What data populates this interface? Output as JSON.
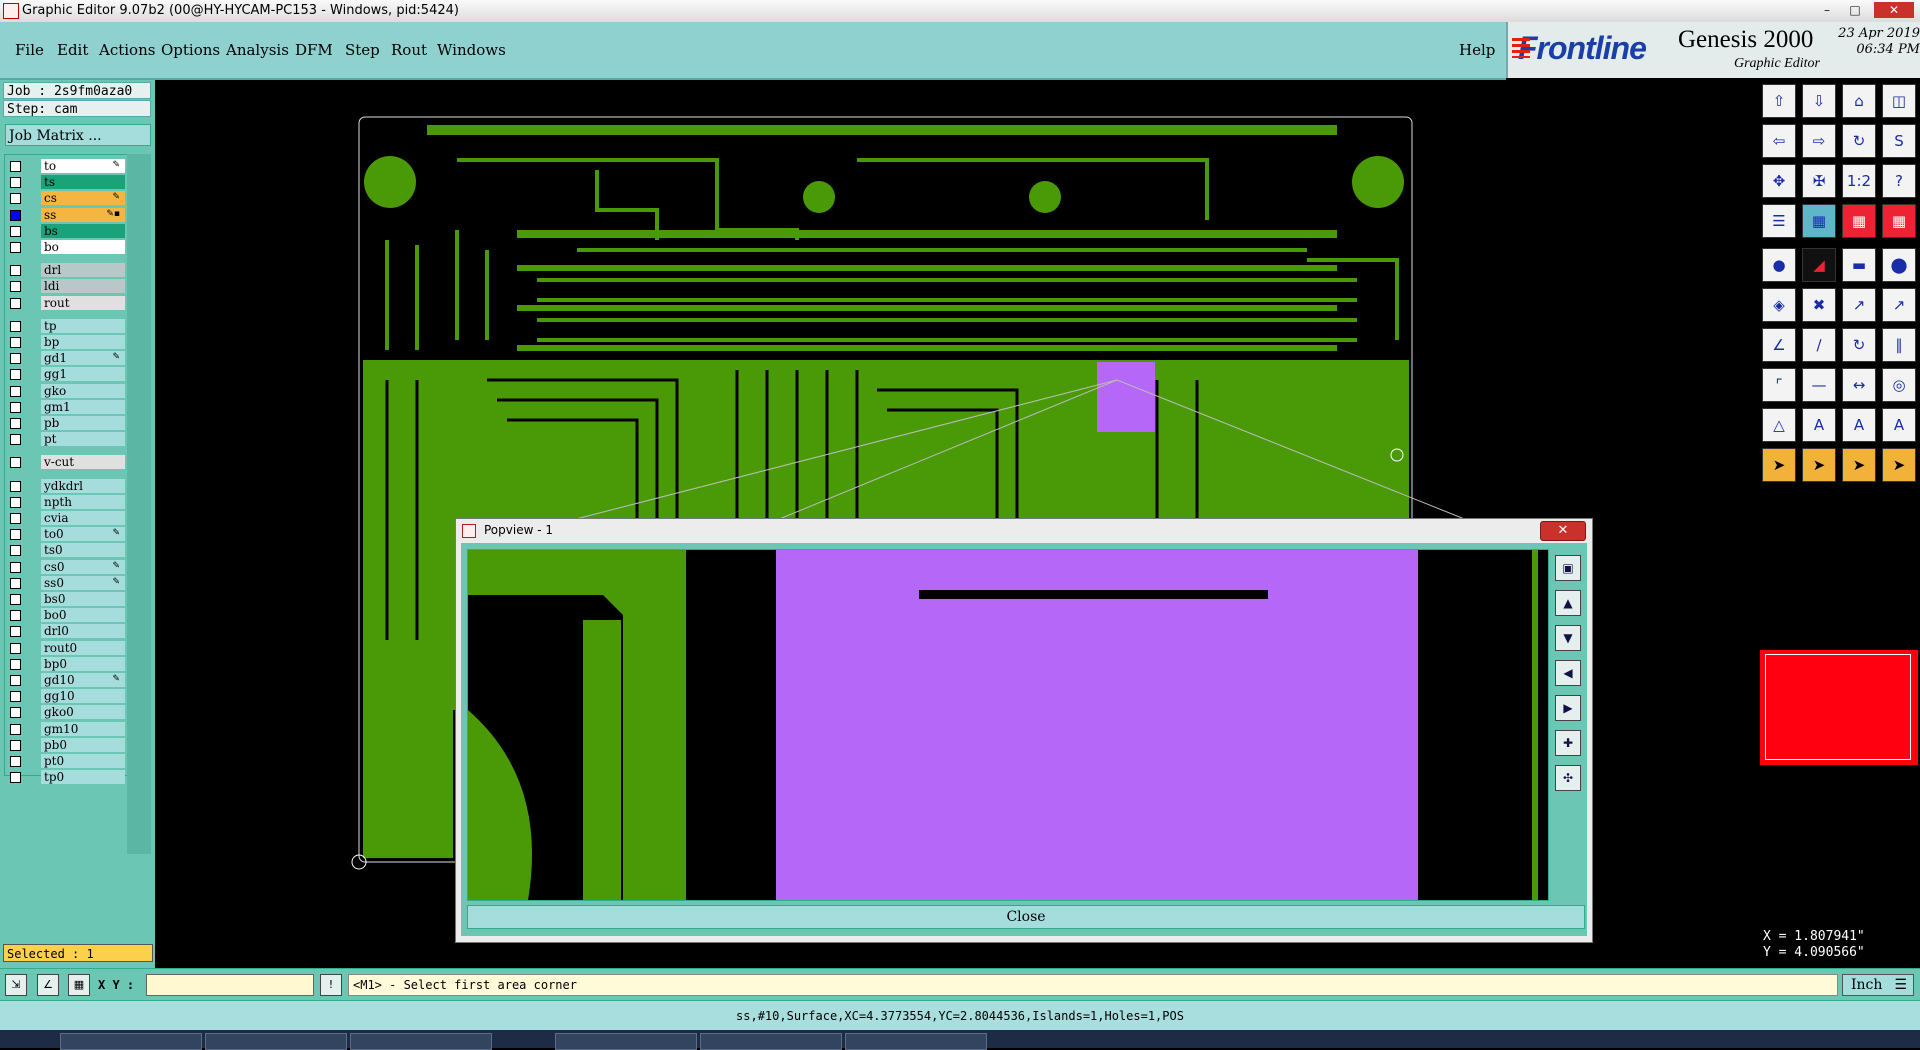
{
  "window": {
    "title": "Graphic Editor 9.07b2 (00@HY-HYCAM-PC153 - Windows, pid:5424)"
  },
  "menu": {
    "items": [
      "File",
      "Edit",
      "Actions",
      "Options",
      "Analysis",
      "DFM",
      "Step",
      "Rout",
      "Windows"
    ],
    "help": "Help"
  },
  "brand": {
    "logo": "Frontline",
    "product": "Genesis 2000",
    "subtitle": "Graphic Editor",
    "date": "23 Apr 2019",
    "time": "06:34 PM"
  },
  "job": {
    "job_label": "Job : 2s9fm0aza0",
    "step_label": "Step: cam",
    "matrix_button": "Job Matrix ..."
  },
  "layers": [
    {
      "name": "to",
      "color": "#ffffff",
      "checked": false,
      "mark": "✎"
    },
    {
      "name": "ts",
      "color": "#1aa37a",
      "checked": false,
      "mark": ""
    },
    {
      "name": "cs",
      "color": "#f4b640",
      "checked": false,
      "mark": "✎"
    },
    {
      "name": "ss",
      "color": "#f4b640",
      "checked": true,
      "mark": "✎▪"
    },
    {
      "name": "bs",
      "color": "#1aa37a",
      "checked": false,
      "mark": ""
    },
    {
      "name": "bo",
      "color": "#ffffff",
      "checked": false,
      "mark": ""
    },
    {
      "name": "drl",
      "color": "#b8c8c8",
      "checked": false,
      "mark": ""
    },
    {
      "name": "ldi",
      "color": "#b8c8c8",
      "checked": false,
      "mark": ""
    },
    {
      "name": "rout",
      "color": "#e0e0e0",
      "checked": false,
      "mark": ""
    },
    {
      "name": "tp",
      "color": "#a5dcdc",
      "checked": false,
      "mark": ""
    },
    {
      "name": "bp",
      "color": "#a5dcdc",
      "checked": false,
      "mark": ""
    },
    {
      "name": "gd1",
      "color": "#a5dcdc",
      "checked": false,
      "mark": "✎"
    },
    {
      "name": "gg1",
      "color": "#a5dcdc",
      "checked": false,
      "mark": ""
    },
    {
      "name": "gko",
      "color": "#a5dcdc",
      "checked": false,
      "mark": ""
    },
    {
      "name": "gm1",
      "color": "#a5dcdc",
      "checked": false,
      "mark": ""
    },
    {
      "name": "pb",
      "color": "#a5dcdc",
      "checked": false,
      "mark": ""
    },
    {
      "name": "pt",
      "color": "#a5dcdc",
      "checked": false,
      "mark": ""
    },
    {
      "name": "v-cut",
      "color": "#e0e0e0",
      "checked": false,
      "mark": ""
    },
    {
      "name": "ydkdrl",
      "color": "#a5dcdc",
      "checked": false,
      "mark": ""
    },
    {
      "name": "npth",
      "color": "#a5dcdc",
      "checked": false,
      "mark": ""
    },
    {
      "name": "cvia",
      "color": "#a5dcdc",
      "checked": false,
      "mark": ""
    },
    {
      "name": "to0",
      "color": "#a5dcdc",
      "checked": false,
      "mark": "✎"
    },
    {
      "name": "ts0",
      "color": "#a5dcdc",
      "checked": false,
      "mark": ""
    },
    {
      "name": "cs0",
      "color": "#a5dcdc",
      "checked": false,
      "mark": "✎"
    },
    {
      "name": "ss0",
      "color": "#a5dcdc",
      "checked": false,
      "mark": "✎"
    },
    {
      "name": "bs0",
      "color": "#a5dcdc",
      "checked": false,
      "mark": ""
    },
    {
      "name": "bo0",
      "color": "#a5dcdc",
      "checked": false,
      "mark": ""
    },
    {
      "name": "drl0",
      "color": "#a5dcdc",
      "checked": false,
      "mark": ""
    },
    {
      "name": "rout0",
      "color": "#a5dcdc",
      "checked": false,
      "mark": ""
    },
    {
      "name": "bp0",
      "color": "#a5dcdc",
      "checked": false,
      "mark": ""
    },
    {
      "name": "gd10",
      "color": "#a5dcdc",
      "checked": false,
      "mark": "✎"
    },
    {
      "name": "gg10",
      "color": "#a5dcdc",
      "checked": false,
      "mark": ""
    },
    {
      "name": "gko0",
      "color": "#a5dcdc",
      "checked": false,
      "mark": ""
    },
    {
      "name": "gm10",
      "color": "#a5dcdc",
      "checked": false,
      "mark": ""
    },
    {
      "name": "pb0",
      "color": "#a5dcdc",
      "checked": false,
      "mark": ""
    },
    {
      "name": "pt0",
      "color": "#a5dcdc",
      "checked": false,
      "mark": ""
    },
    {
      "name": "tp0",
      "color": "#a5dcdc",
      "checked": false,
      "mark": ""
    }
  ],
  "status": {
    "selected": "Selected : 1",
    "xy_label": "X Y :",
    "xy_value": "",
    "prompt": "<M1> - Select first area corner",
    "unit": "Inch",
    "info": "ss,#10,Surface,XC=4.3773554,YC=2.8044536,Islands=1,Holes=1,POS",
    "x": "X = 1.807941\"",
    "y": "Y = 4.090566\""
  },
  "popview": {
    "title": "Popview - 1",
    "close_label": "Close",
    "close_icon": "close-icon"
  },
  "colors": {
    "board_green": "#4a9a08",
    "highlight_purple": "#b568f8",
    "panel_teal": "#6cc6b4",
    "menubar": "#8ed1cf"
  }
}
